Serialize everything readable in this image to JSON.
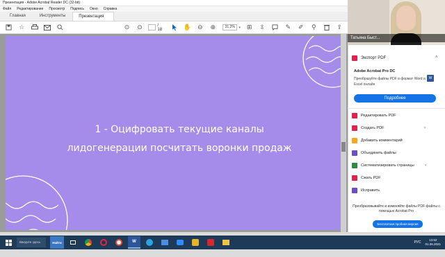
{
  "window": {
    "title": "Презентация - Adobe Acrobat Reader DC (32-bit)"
  },
  "menu": [
    "Файл",
    "Редактирование",
    "Просмотр",
    "Подпись",
    "Окно",
    "Справка"
  ],
  "tabs": {
    "home": "Главная",
    "tools": "Инструменты",
    "document": "Презентация"
  },
  "toolbar": {
    "page_total": "/ 18",
    "zoom": "31,2%"
  },
  "slide": {
    "line1": "1 - Оцифровать текущие каналы",
    "line2": "лидогенерации посчитать воронки продаж",
    "background": "#a58ceb"
  },
  "webcam": {
    "participant_name": "Татьяна Быст..."
  },
  "tools_pane": {
    "export_label": "Экспорт PDF",
    "product_name": "Adobe Acrobat Pro DC",
    "product_desc": "Преобразуйте файлы PDF в формат Word и Excel онлайн",
    "convert_button": "Подробнее",
    "items": [
      {
        "label": "Редактировать PDF",
        "color": "#e0234e"
      },
      {
        "label": "Создать PDF",
        "color": "#e0234e"
      },
      {
        "label": "Добавить комментарий",
        "color": "#f5a623"
      },
      {
        "label": "Объединить файлы",
        "color": "#6b4ec7"
      },
      {
        "label": "Систематизировать страницы",
        "color": "#2e8b3c"
      },
      {
        "label": "Сжать PDF",
        "color": "#e0234e"
      },
      {
        "label": "Исправить",
        "color": "#6b4ec7"
      }
    ],
    "promo_text": "Преобразовывайте и изменяйте файлы PDF-файлы с помощью Acrobat Pro",
    "promo_button": "Бесплатная пробная версия"
  },
  "overlay": {
    "zoom_logo": "zoom"
  },
  "taskbar": {
    "search_text": "Введите здесь текст для поиска",
    "apps": [
      "Найти",
      "",
      "",
      "",
      "",
      "W",
      "",
      "",
      "",
      "",
      "",
      "",
      ""
    ],
    "language": "РУС",
    "time": "13:52",
    "date": "01.06.2021"
  }
}
